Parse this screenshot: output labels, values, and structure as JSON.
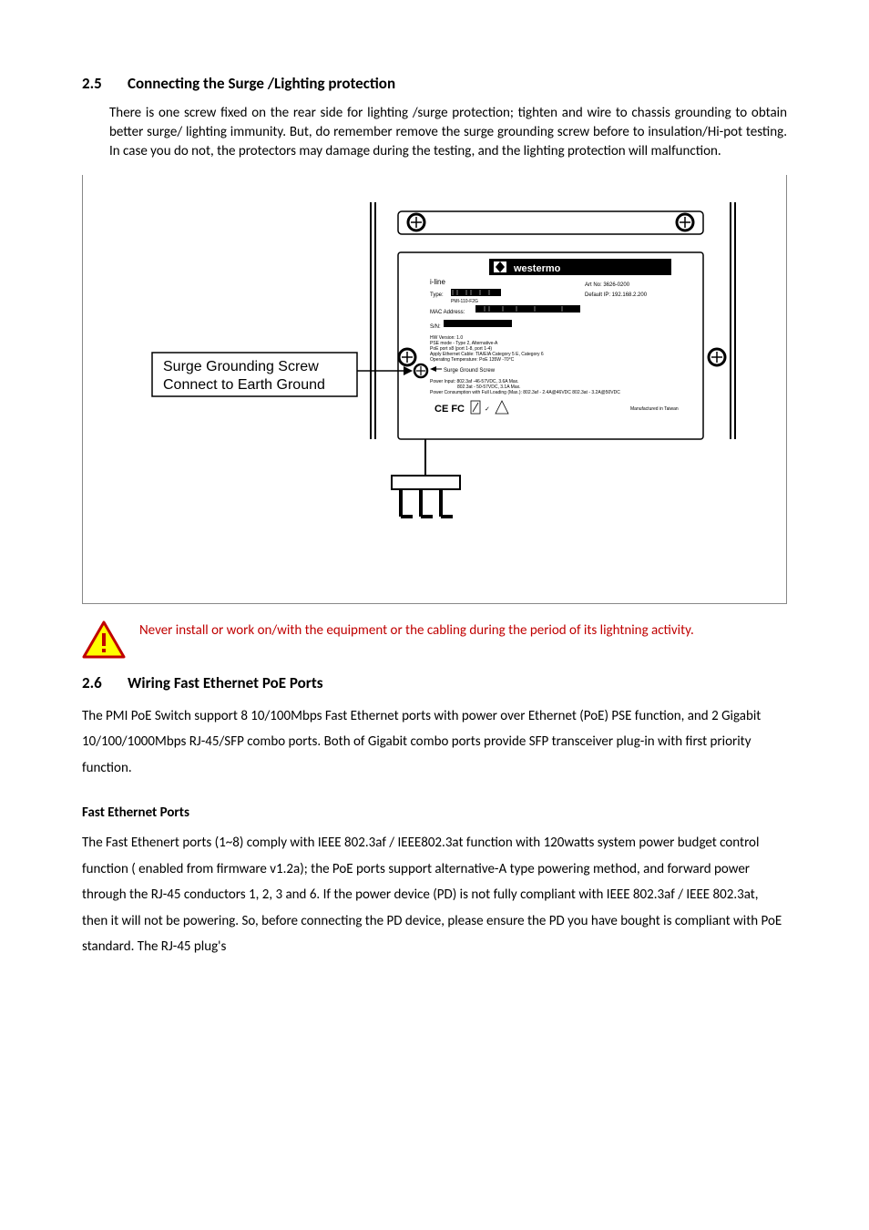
{
  "section25": {
    "number": "2.5",
    "title": "Connecting the Surge /Lighting protection",
    "body": "There is one screw fixed on the rear side for lighting /surge protection; tighten and wire to chassis grounding to obtain better surge/ lighting immunity. But, do remember remove the surge grounding screw before to insulation/Hi-pot testing. In case you do not, the protectors may damage during the testing, and the lighting protection will malfunction."
  },
  "diagram": {
    "callout_line1": "Surge Grounding Screw",
    "callout_line2": "Connect to Earth Ground",
    "panel_brand": "westermo",
    "panel_iline": "i-line",
    "panel_art_no": "Art No: 3626-0200",
    "panel_type_label": "Type:",
    "panel_type_value": "PMI-110-F2G",
    "panel_default_ip": "Default IP: 192.168.2.200",
    "panel_mac_label": "MAC Address:",
    "panel_sn_label": "S/N:",
    "panel_hw": "HW Version: 1.0",
    "panel_pse_mode": "PSE mode - Type 2, Alternative-A",
    "panel_poe": "PoE port x8 (port 1-8, port 1-4)",
    "panel_cable": "Apply Ethernet Cable: TIA/EIA Category 5 E, Category 6",
    "panel_temp": "Operating Temperature: PoE 135W -70°C",
    "panel_surge_arrow": "Surge Ground Screw",
    "panel_power_input_1": "Power Input: 802.3af -46-57VDC, 3.6A Max.",
    "panel_power_input_2": "802.3at - 50-57VDC, 3.1A Max.",
    "panel_power_consumption": "Power Consumption with Full Loading (Max.): 802.3af - 2.4A@46VDC   802.3at - 3.2A@50VDC",
    "panel_made_in": "Manufactured in Taiwan"
  },
  "warning": {
    "text": "Never install or work on/with the equipment or the cabling during the period of its lightning activity."
  },
  "section26": {
    "number": "2.6",
    "title": "Wiring Fast Ethernet PoE Ports",
    "body": "The PMI PoE Switch support 8 10/100Mbps Fast Ethernet ports with power over Ethernet (PoE) PSE function, and 2 Gigabit 10/100/1000Mbps RJ-45/SFP combo ports. Both of Gigabit combo ports provide SFP transceiver plug-in with first priority function."
  },
  "fast_ethernet": {
    "heading": "Fast Ethernet Ports",
    "body": "The Fast Ethenert ports (1~8) comply with IEEE 802.3af / IEEE802.3at function with 120watts system power budget control function ( enabled from firmware v1.2a); the PoE ports support alternative-A type powering method, and forward power through the RJ-45 conductors 1, 2, 3 and 6. If the power device (PD) is not fully compliant with IEEE 802.3af / IEEE 802.3at, then it will not be powering. So, before connecting the PD device, please ensure the PD you have bought is compliant with PoE standard. The RJ-45 plug's"
  }
}
